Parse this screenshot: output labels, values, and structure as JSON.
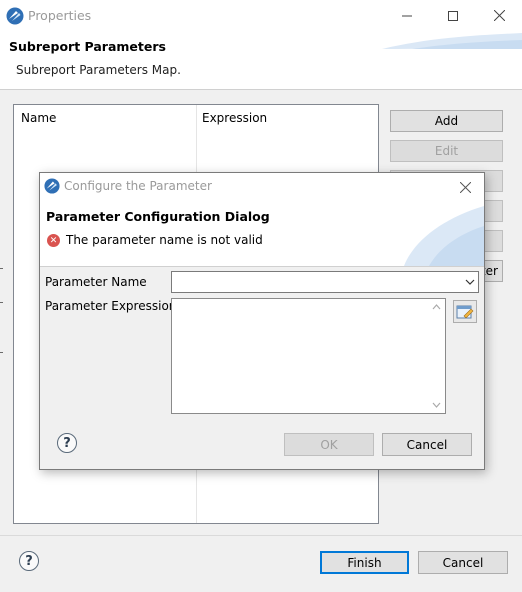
{
  "outer_window": {
    "title": "Properties",
    "heading": "Subreport Parameters",
    "description": "Subreport Parameters Map.",
    "table": {
      "columns": [
        "Name",
        "Expression"
      ]
    },
    "side_buttons": [
      {
        "label": "Add",
        "enabled": true
      },
      {
        "label": "Edit",
        "enabled": false
      },
      {
        "label": "",
        "enabled": false
      },
      {
        "label": "",
        "enabled": false
      },
      {
        "label": "",
        "enabled": false
      },
      {
        "label": "ter",
        "enabled": true
      }
    ],
    "footer": {
      "help_glyph": "?",
      "finish_label": "Finish",
      "cancel_label": "Cancel"
    }
  },
  "inner_dialog": {
    "title": "Configure the Parameter",
    "heading": "Parameter Configuration Dialog",
    "error_message": "The parameter name is not valid",
    "fields": {
      "name_label": "Parameter Name",
      "name_value": "",
      "expression_label": "Parameter Expression",
      "expression_value": ""
    },
    "footer": {
      "help_glyph": "?",
      "ok_label": "OK",
      "cancel_label": "Cancel"
    }
  },
  "icons": {
    "app": "jaspersoft-logo-icon",
    "error": "error-circle-icon",
    "expression_editor": "expression-editor-icon",
    "help": "help-circle-icon"
  },
  "colors": {
    "accent_blue": "#0078d7",
    "error_red": "#d9534f",
    "window_bg": "#f0f0f0"
  }
}
